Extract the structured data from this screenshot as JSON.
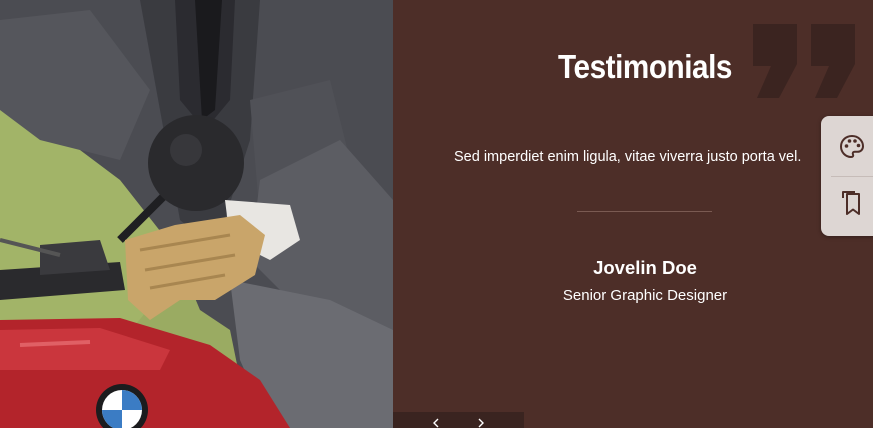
{
  "section": {
    "title": "Testimonials"
  },
  "testimonial": {
    "quote": "Sed imperdiet enim ligula, vitae viverra justo porta vel.",
    "author_name": "Jovelin Doe",
    "author_role": "Senior Graphic Designer"
  },
  "colors": {
    "panel_background": "#4d2e28",
    "quote_mark": "#3b2420",
    "text": "#ffffff",
    "toolbar_background": "#ddd6d3",
    "toolbar_icon": "#4d2e28"
  },
  "icons": {
    "quote": "quote-icon",
    "palette": "palette-icon",
    "bookmarks": "bookmarks-icon",
    "prev": "chevron-left-icon",
    "next": "chevron-right-icon"
  }
}
